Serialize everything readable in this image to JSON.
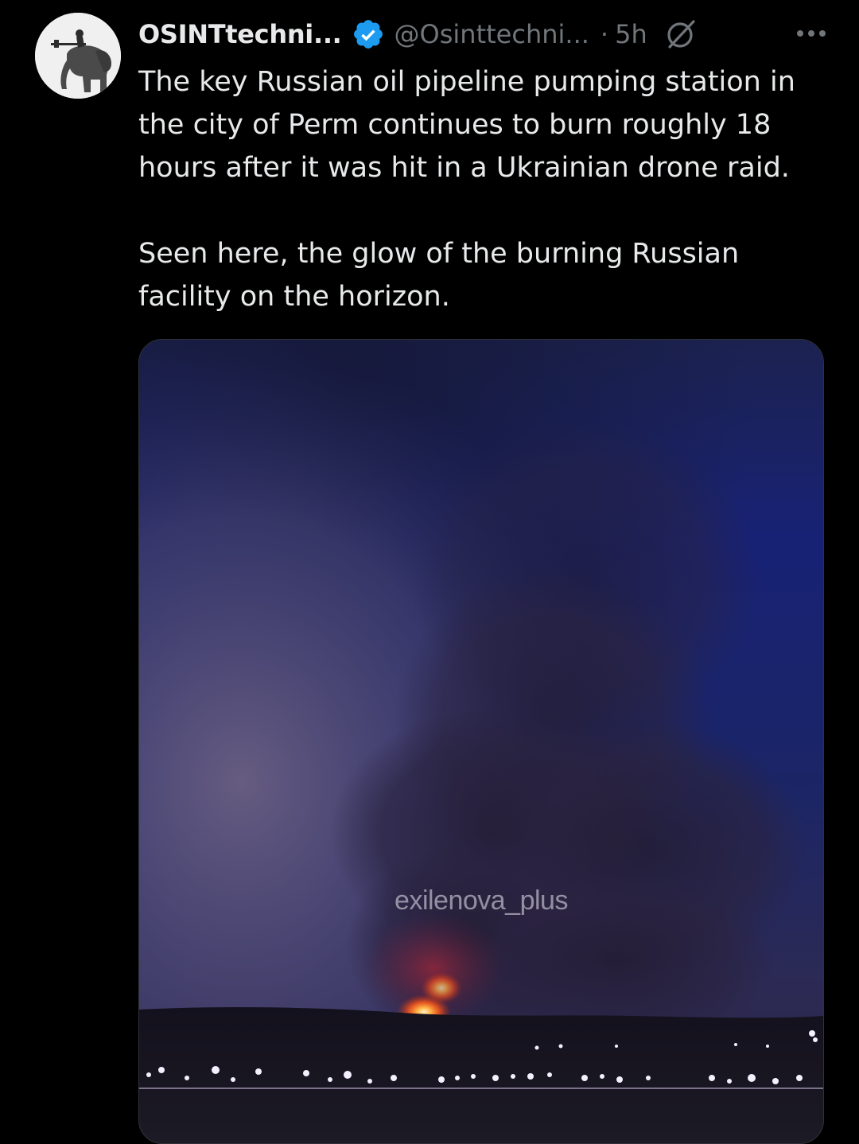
{
  "tweet": {
    "author": {
      "display_name": "OSINTtechni...",
      "handle": "@Osinttechni...",
      "verified": true,
      "avatar_icon": "soldier-on-elephant-avatar"
    },
    "separator": "·",
    "timestamp": "5h",
    "text_paragraphs": [
      "The key Russian oil pipeline pumping station in the city of Perm continues to burn roughly 18 hours after it was hit in a Ukrainian drone raid.",
      "Seen here, the glow of the burning Russian facility on the horizon."
    ],
    "media": {
      "watermark": "exilenova_plus"
    },
    "icons": {
      "verified": "verified-badge-icon",
      "grok": "grok-icon",
      "more": "more-options-icon"
    },
    "colors": {
      "background": "#000000",
      "primary_text": "#e7e9ea",
      "secondary_text": "#71767b",
      "verified_blue": "#1d9bf0",
      "fire_orange": "#ff6a1a"
    }
  }
}
